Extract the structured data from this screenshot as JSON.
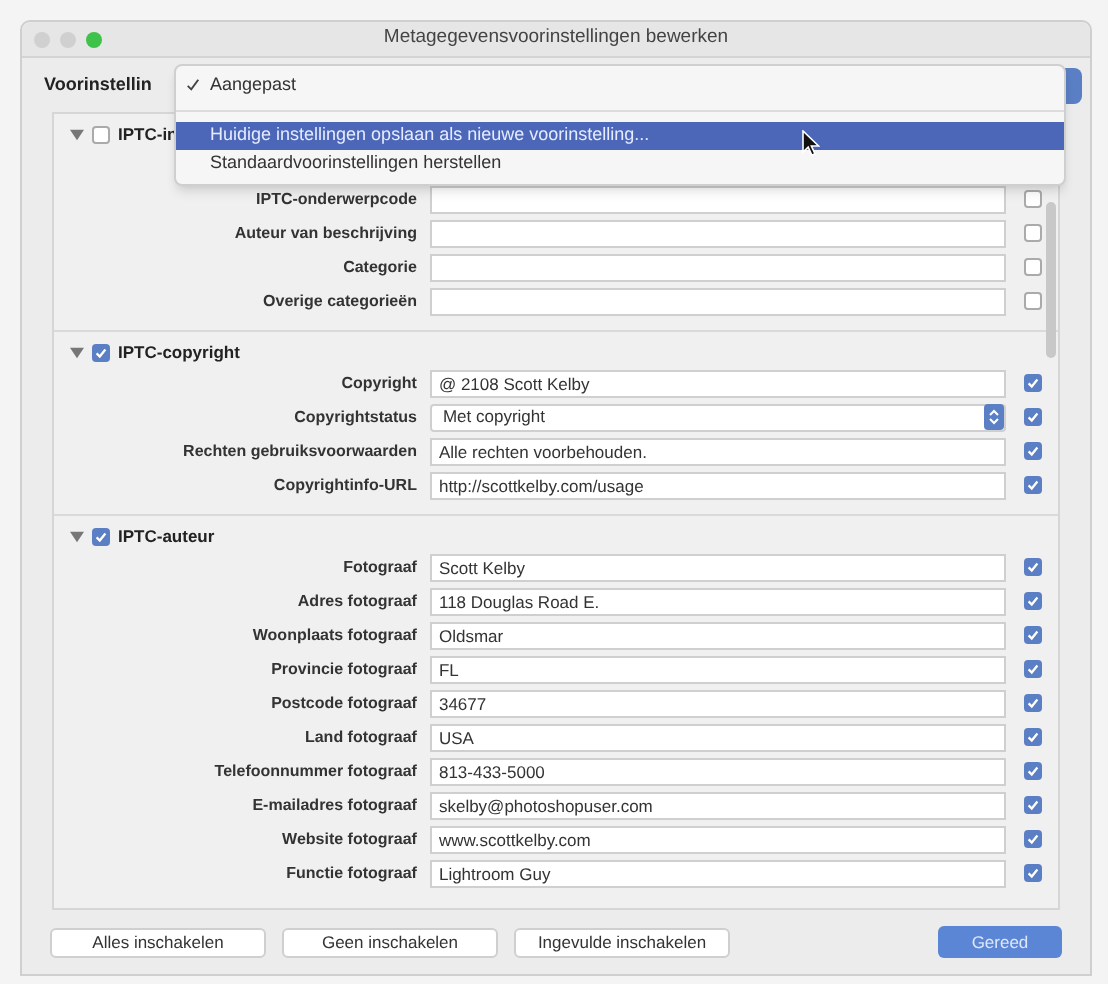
{
  "window": {
    "title": "Metagegevensvoorinstellingen bewerken"
  },
  "preset": {
    "label": "Voorinstellin"
  },
  "menu": {
    "items": [
      {
        "label": "Aangepast",
        "checked": true,
        "highlighted": false,
        "separator_after": true
      },
      {
        "label": "Huidige instellingen opslaan als nieuwe voorinstelling...",
        "checked": false,
        "highlighted": true,
        "separator_after": false
      },
      {
        "label": "Standaardvoorinstellingen herstellen",
        "checked": false,
        "highlighted": false,
        "separator_after": false
      }
    ]
  },
  "sections": [
    {
      "title": "IPTC-in",
      "expanded": true,
      "checked": false,
      "rows": [
        {
          "kind": "text",
          "label": "IPTC-onderwerpcode",
          "value": "",
          "checked": false
        },
        {
          "kind": "text",
          "label": "Auteur van beschrijving",
          "value": "",
          "checked": false
        },
        {
          "kind": "text",
          "label": "Categorie",
          "value": "",
          "checked": false
        },
        {
          "kind": "text",
          "label": "Overige categorieën",
          "value": "",
          "checked": false
        }
      ]
    },
    {
      "title": "IPTC-copyright",
      "expanded": true,
      "checked": true,
      "rows": [
        {
          "kind": "text",
          "label": "Copyright",
          "value": "@ 2108 Scott Kelby",
          "checked": true
        },
        {
          "kind": "select",
          "label": "Copyrightstatus",
          "value": "Met copyright",
          "checked": true
        },
        {
          "kind": "text",
          "label": "Rechten gebruiksvoorwaarden",
          "value": "Alle rechten voorbehouden.",
          "checked": true
        },
        {
          "kind": "text",
          "label": "Copyrightinfo-URL",
          "value": "http://scottkelby.com/usage",
          "checked": true
        }
      ]
    },
    {
      "title": "IPTC-auteur",
      "expanded": true,
      "checked": true,
      "rows": [
        {
          "kind": "text",
          "label": "Fotograaf",
          "value": "Scott Kelby",
          "checked": true
        },
        {
          "kind": "text",
          "label": "Adres fotograaf",
          "value": "118 Douglas Road E.",
          "checked": true
        },
        {
          "kind": "text",
          "label": "Woonplaats fotograaf",
          "value": "Oldsmar",
          "checked": true
        },
        {
          "kind": "text",
          "label": "Provincie fotograaf",
          "value": "FL",
          "checked": true
        },
        {
          "kind": "text",
          "label": "Postcode fotograaf",
          "value": "34677",
          "checked": true
        },
        {
          "kind": "text",
          "label": "Land fotograaf",
          "value": "USA",
          "checked": true
        },
        {
          "kind": "text",
          "label": "Telefoonnummer fotograaf",
          "value": "813-433-5000",
          "checked": true
        },
        {
          "kind": "text",
          "label": "E-mailadres fotograaf",
          "value": "skelby@photoshopuser.com",
          "checked": true
        },
        {
          "kind": "text",
          "label": "Website fotograaf",
          "value": "www.scottkelby.com",
          "checked": true
        },
        {
          "kind": "text",
          "label": "Functie fotograaf",
          "value": "Lightroom Guy",
          "checked": true
        }
      ]
    }
  ],
  "buttons": [
    {
      "label": "Alles inschakelen",
      "kind": "secondary"
    },
    {
      "label": "Geen inschakelen",
      "kind": "secondary"
    },
    {
      "label": "Ingevulde inschakelen",
      "kind": "secondary"
    },
    {
      "label": "Gereed",
      "kind": "primary"
    }
  ]
}
